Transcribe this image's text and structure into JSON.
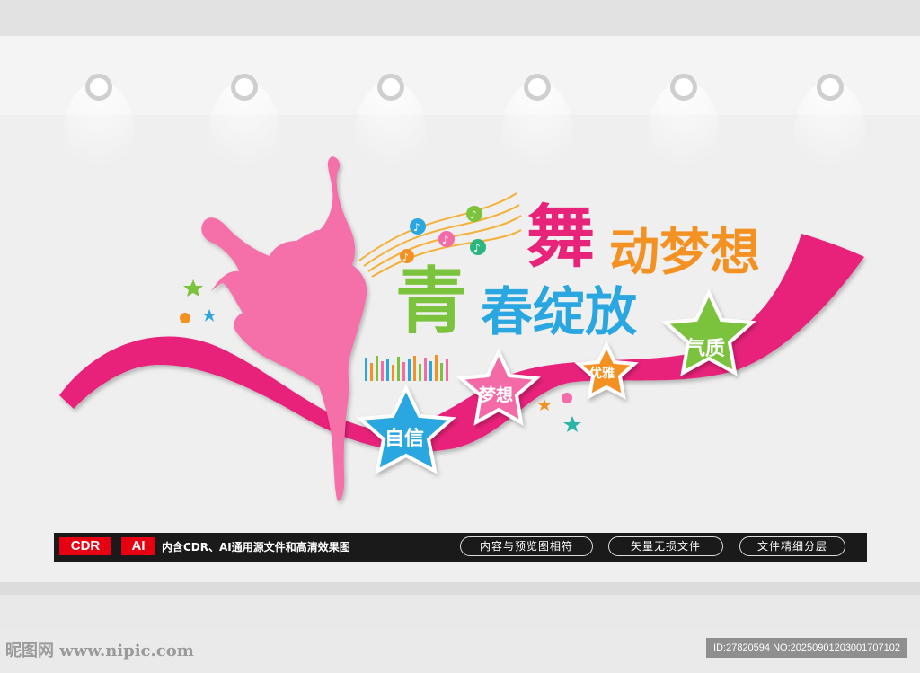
{
  "title": {
    "line1_big": "舞",
    "line1_rest": "动梦想",
    "line2_big": "青",
    "line2_rest": "春绽放"
  },
  "stars": {
    "confidence": "自信",
    "dream": "梦想",
    "elegance": "优雅",
    "temperament": "气质"
  },
  "bar": {
    "cdr_tag": "CDR",
    "ai_tag": "AI",
    "description": "内含CDR、AI通用源文件和高清效果图",
    "pill1": "内容与预览图相符",
    "pill2": "矢量无损文件",
    "pill3": "文件精细分层"
  },
  "watermark": {
    "site": "昵图网 www.nipic.com",
    "id_text": "ID:27820594 NO:20250901203001707102"
  },
  "colors": {
    "wall": "#efefef",
    "ribbon": "#e8237a",
    "dancer": "#f56fa8",
    "blue": "#2aa7e0",
    "green": "#7cc33d",
    "orange": "#f39222",
    "pink": "#f46ba7",
    "cdr_red": "#e60012"
  },
  "icons": [
    "spotlight-icon",
    "dancer-icon",
    "music-note-icon",
    "star-icon",
    "equalizer-icon"
  ]
}
